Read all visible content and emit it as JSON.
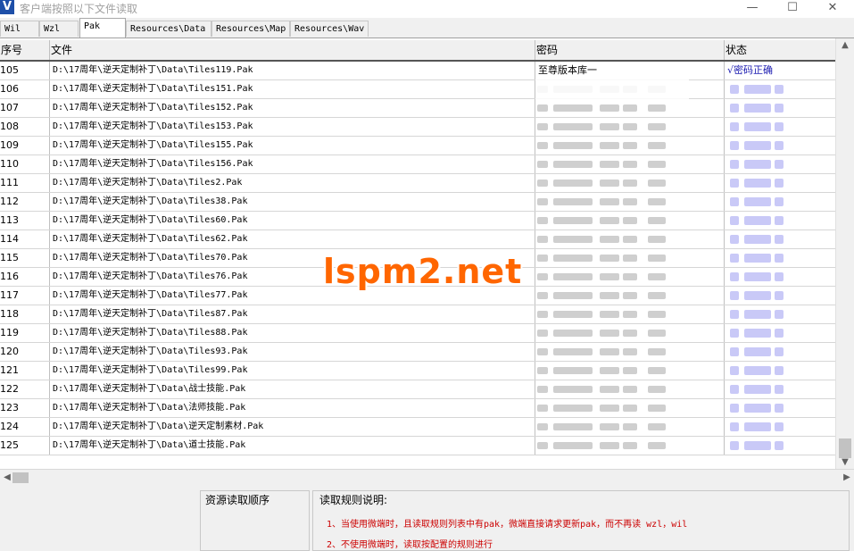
{
  "window": {
    "title": "客户端按照以下文件读取",
    "icon_glyph": "V",
    "minimize": "—",
    "maximize": "☐",
    "close": "✕"
  },
  "tabs": [
    {
      "label": "Wil",
      "active": false
    },
    {
      "label": "Wzl",
      "active": false
    },
    {
      "label": "Pak",
      "active": true
    },
    {
      "label": "Resources\\Data",
      "active": false
    },
    {
      "label": "Resources\\Map",
      "active": false
    },
    {
      "label": "Resources\\Wav",
      "active": false
    }
  ],
  "table": {
    "columns": {
      "no": "序号",
      "file": "文件",
      "password": "密码",
      "status": "状态"
    },
    "first_row_password": "至尊版本库一",
    "first_row_status": "√密码正确",
    "rows": [
      {
        "no": "105",
        "file": "D:\\17周年\\逆天定制补丁\\Data\\Tiles119.Pak"
      },
      {
        "no": "106",
        "file": "D:\\17周年\\逆天定制补丁\\Data\\Tiles151.Pak"
      },
      {
        "no": "107",
        "file": "D:\\17周年\\逆天定制补丁\\Data\\Tiles152.Pak"
      },
      {
        "no": "108",
        "file": "D:\\17周年\\逆天定制补丁\\Data\\Tiles153.Pak"
      },
      {
        "no": "109",
        "file": "D:\\17周年\\逆天定制补丁\\Data\\Tiles155.Pak"
      },
      {
        "no": "110",
        "file": "D:\\17周年\\逆天定制补丁\\Data\\Tiles156.Pak"
      },
      {
        "no": "111",
        "file": "D:\\17周年\\逆天定制补丁\\Data\\Tiles2.Pak"
      },
      {
        "no": "112",
        "file": "D:\\17周年\\逆天定制补丁\\Data\\Tiles38.Pak"
      },
      {
        "no": "113",
        "file": "D:\\17周年\\逆天定制补丁\\Data\\Tiles60.Pak"
      },
      {
        "no": "114",
        "file": "D:\\17周年\\逆天定制补丁\\Data\\Tiles62.Pak"
      },
      {
        "no": "115",
        "file": "D:\\17周年\\逆天定制补丁\\Data\\Tiles70.Pak"
      },
      {
        "no": "116",
        "file": "D:\\17周年\\逆天定制补丁\\Data\\Tiles76.Pak"
      },
      {
        "no": "117",
        "file": "D:\\17周年\\逆天定制补丁\\Data\\Tiles77.Pak"
      },
      {
        "no": "118",
        "file": "D:\\17周年\\逆天定制补丁\\Data\\Tiles87.Pak"
      },
      {
        "no": "119",
        "file": "D:\\17周年\\逆天定制补丁\\Data\\Tiles88.Pak"
      },
      {
        "no": "120",
        "file": "D:\\17周年\\逆天定制补丁\\Data\\Tiles93.Pak"
      },
      {
        "no": "121",
        "file": "D:\\17周年\\逆天定制补丁\\Data\\Tiles99.Pak"
      },
      {
        "no": "122",
        "file": "D:\\17周年\\逆天定制补丁\\Data\\战士技能.Pak"
      },
      {
        "no": "123",
        "file": "D:\\17周年\\逆天定制补丁\\Data\\法师技能.Pak"
      },
      {
        "no": "124",
        "file": "D:\\17周年\\逆天定制补丁\\Data\\逆天定制素材.Pak"
      },
      {
        "no": "125",
        "file": "D:\\17周年\\逆天定制补丁\\Data\\道士技能.Pak"
      }
    ]
  },
  "scroll": {
    "up": "▲",
    "down": "▼",
    "left": "◀",
    "right": "▶"
  },
  "bottom": {
    "load_order_label": "资源读取顺序",
    "rules_title": "读取规则说明:",
    "rule1": "1、当使用微端时，且读取规则列表中有pak，微端直接请求更新pak，而不再读 wzl，wil",
    "rule2": "2、不使用微端时，读取按配置的规则进行"
  },
  "watermark": "lspm2.net"
}
